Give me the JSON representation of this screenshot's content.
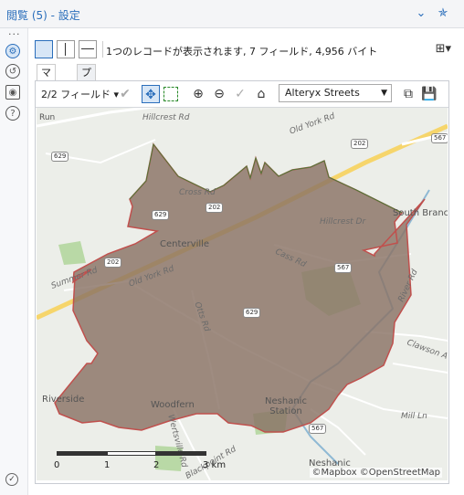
{
  "window": {
    "title": "閲覧 (5) - 設定"
  },
  "left_toolbar": {
    "dots": "···",
    "icons": [
      "gear-icon",
      "share-icon",
      "tag-icon",
      "help-icon"
    ],
    "bottom_icon": "check-circle-icon"
  },
  "view_toolbar": {
    "status": "1つのレコードが表示されます, 7 フィールド, 4,956 バイト"
  },
  "tabs": [
    {
      "label": "マップ",
      "active": true
    },
    {
      "label": "プロファイル",
      "active": false
    }
  ],
  "map_toolbar": {
    "field_selector": "2/2 フィールド",
    "basemap": "Alteryx Streets"
  },
  "map": {
    "places": [
      "Centerville",
      "Riverside",
      "Woodfern",
      "Neshanic Station",
      "Neshanic",
      "South Branch"
    ],
    "roads": [
      "Hillcrest Rd",
      "Old York Rd",
      "Cross Rd",
      "Hillcrest Dr",
      "Old York Rd",
      "Cass Rd",
      "Otts Rd",
      "Summer Rd",
      "Clawson Ave",
      "River Rd",
      "Mill Ln",
      "Blackpoint Rd",
      "Wertsville Rd",
      "Run"
    ],
    "shields": [
      "202",
      "202",
      "629",
      "629",
      "567",
      "567",
      "567",
      "629",
      "202"
    ],
    "scale_labels": [
      "0",
      "1",
      "2",
      "3 km"
    ],
    "attribution": "©Mapbox ©OpenStreetMap",
    "polygon_fill": "#8a7365",
    "polygon_stroke": "#c0504d"
  }
}
